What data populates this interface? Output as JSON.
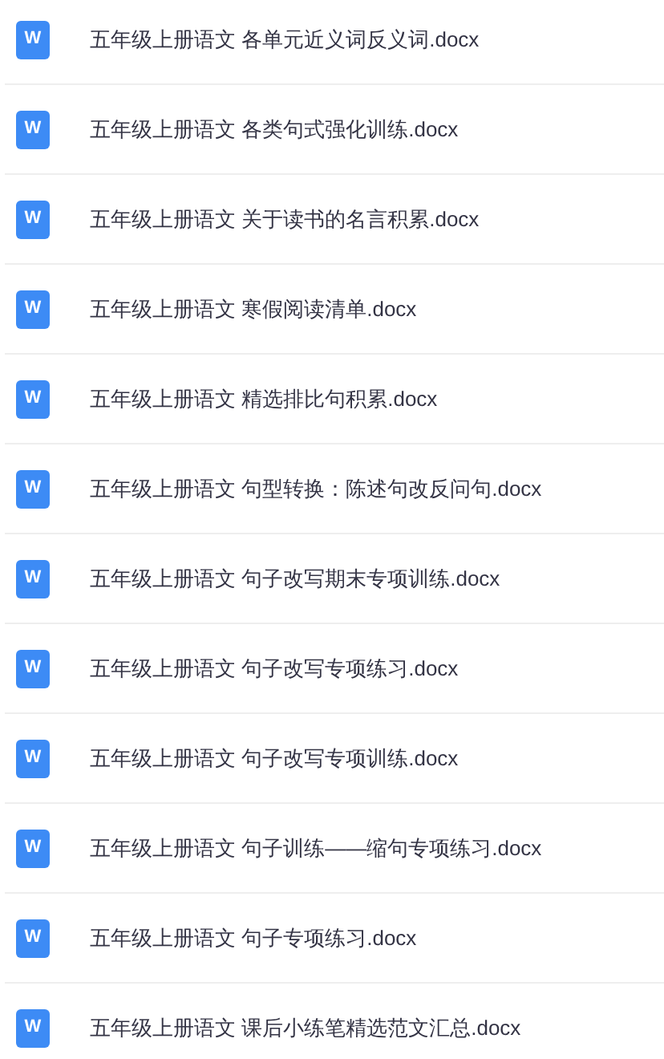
{
  "files": [
    {
      "icon": "W",
      "name": "五年级上册语文 各单元近义词反义词.docx"
    },
    {
      "icon": "W",
      "name": "五年级上册语文 各类句式强化训练.docx"
    },
    {
      "icon": "W",
      "name": "五年级上册语文 关于读书的名言积累.docx"
    },
    {
      "icon": "W",
      "name": "五年级上册语文 寒假阅读清单.docx"
    },
    {
      "icon": "W",
      "name": "五年级上册语文 精选排比句积累.docx"
    },
    {
      "icon": "W",
      "name": "五年级上册语文 句型转换：陈述句改反问句.docx"
    },
    {
      "icon": "W",
      "name": "五年级上册语文 句子改写期末专项训练.docx"
    },
    {
      "icon": "W",
      "name": "五年级上册语文 句子改写专项练习.docx"
    },
    {
      "icon": "W",
      "name": "五年级上册语文 句子改写专项训练.docx"
    },
    {
      "icon": "W",
      "name": "五年级上册语文 句子训练——缩句专项练习.docx"
    },
    {
      "icon": "W",
      "name": "五年级上册语文 句子专项练习.docx"
    },
    {
      "icon": "W",
      "name": "五年级上册语文 课后小练笔精选范文汇总.docx"
    }
  ]
}
